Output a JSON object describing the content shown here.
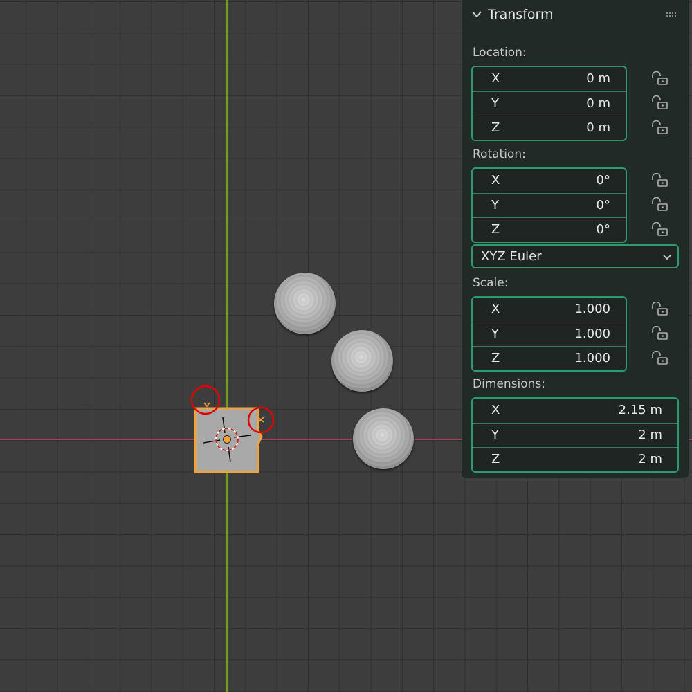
{
  "panel": {
    "title": "Transform",
    "location": {
      "label": "Location:",
      "fields": [
        {
          "axis": "X",
          "value": "0 m"
        },
        {
          "axis": "Y",
          "value": "0 m"
        },
        {
          "axis": "Z",
          "value": "0 m"
        }
      ]
    },
    "rotation": {
      "label": "Rotation:",
      "fields": [
        {
          "axis": "X",
          "value": "0°"
        },
        {
          "axis": "Y",
          "value": "0°"
        },
        {
          "axis": "Z",
          "value": "0°"
        }
      ],
      "mode": "XYZ Euler"
    },
    "scale": {
      "label": "Scale:",
      "fields": [
        {
          "axis": "X",
          "value": "1.000"
        },
        {
          "axis": "Y",
          "value": "1.000"
        },
        {
          "axis": "Z",
          "value": "1.000"
        }
      ]
    },
    "dimensions": {
      "label": "Dimensions:",
      "fields": [
        {
          "axis": "X",
          "value": "2.15 m"
        },
        {
          "axis": "Y",
          "value": "2 m"
        },
        {
          "axis": "Z",
          "value": "2 m"
        }
      ]
    }
  },
  "icons": {
    "collapse": "chevron-down-icon",
    "drag": "grip-icon",
    "lock": "unlock-icon",
    "dropdown": "chevron-down-icon"
  },
  "colors": {
    "viewport_bg": "#3d3d3d",
    "grid": "#303030",
    "y_axis": "#6f9a1e",
    "x_axis": "#a3424f",
    "selection": "#f5a13a",
    "field_border": "#2e9a70",
    "panel_bg": "#222a27",
    "annotation": "#e00000"
  }
}
